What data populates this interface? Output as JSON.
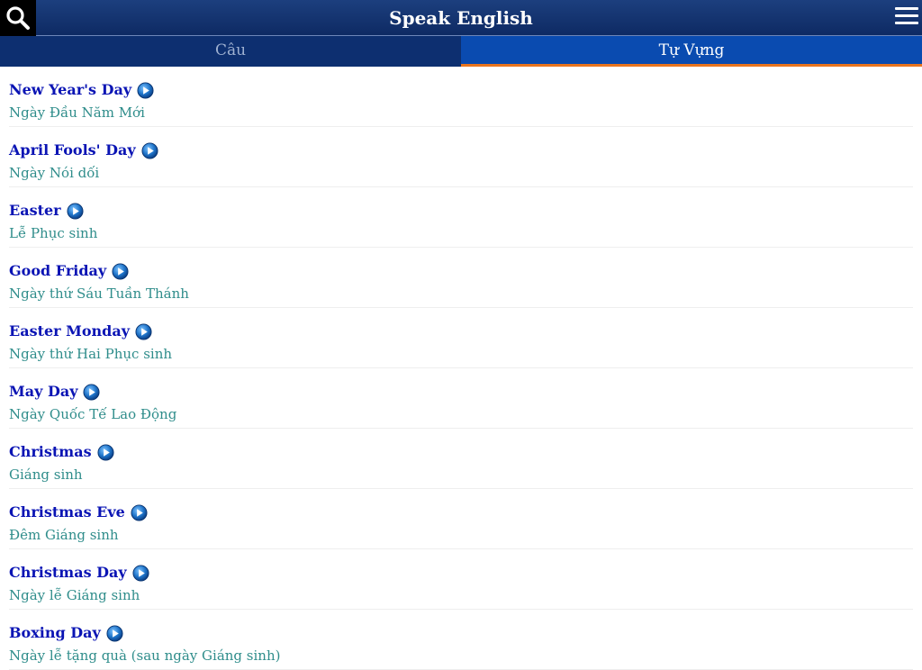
{
  "header": {
    "title": "Speak English",
    "search_icon": "search-icon",
    "menu_icon": "hamburger-menu-icon"
  },
  "tabs": [
    {
      "label": "Câu",
      "active": false
    },
    {
      "label": "Tự Vựng",
      "active": true
    }
  ],
  "colors": {
    "header_bg": "#1c3f7e",
    "active_tab_bg": "#0a4bb0",
    "active_tab_indicator": "#e8741e",
    "english_text": "#0a14b4",
    "vietnamese_text": "#2f8d8b"
  },
  "vocabulary": [
    {
      "en": "New Year's Day",
      "vi": "Ngày Đầu Năm Mới"
    },
    {
      "en": "April Fools' Day",
      "vi": "Ngày Nói dối"
    },
    {
      "en": "Easter",
      "vi": "Lễ Phục sinh"
    },
    {
      "en": "Good Friday",
      "vi": "Ngày thứ Sáu Tuần Thánh"
    },
    {
      "en": "Easter Monday",
      "vi": "Ngày thứ Hai Phục sinh"
    },
    {
      "en": "May Day",
      "vi": "Ngày Quốc Tế Lao Động"
    },
    {
      "en": "Christmas",
      "vi": "Giáng sinh"
    },
    {
      "en": "Christmas Eve",
      "vi": "Đêm Giáng sinh"
    },
    {
      "en": "Christmas Day",
      "vi": "Ngày lễ Giáng sinh"
    },
    {
      "en": "Boxing Day",
      "vi": "Ngày lễ tặng quà (sau ngày Giáng sinh)"
    }
  ]
}
